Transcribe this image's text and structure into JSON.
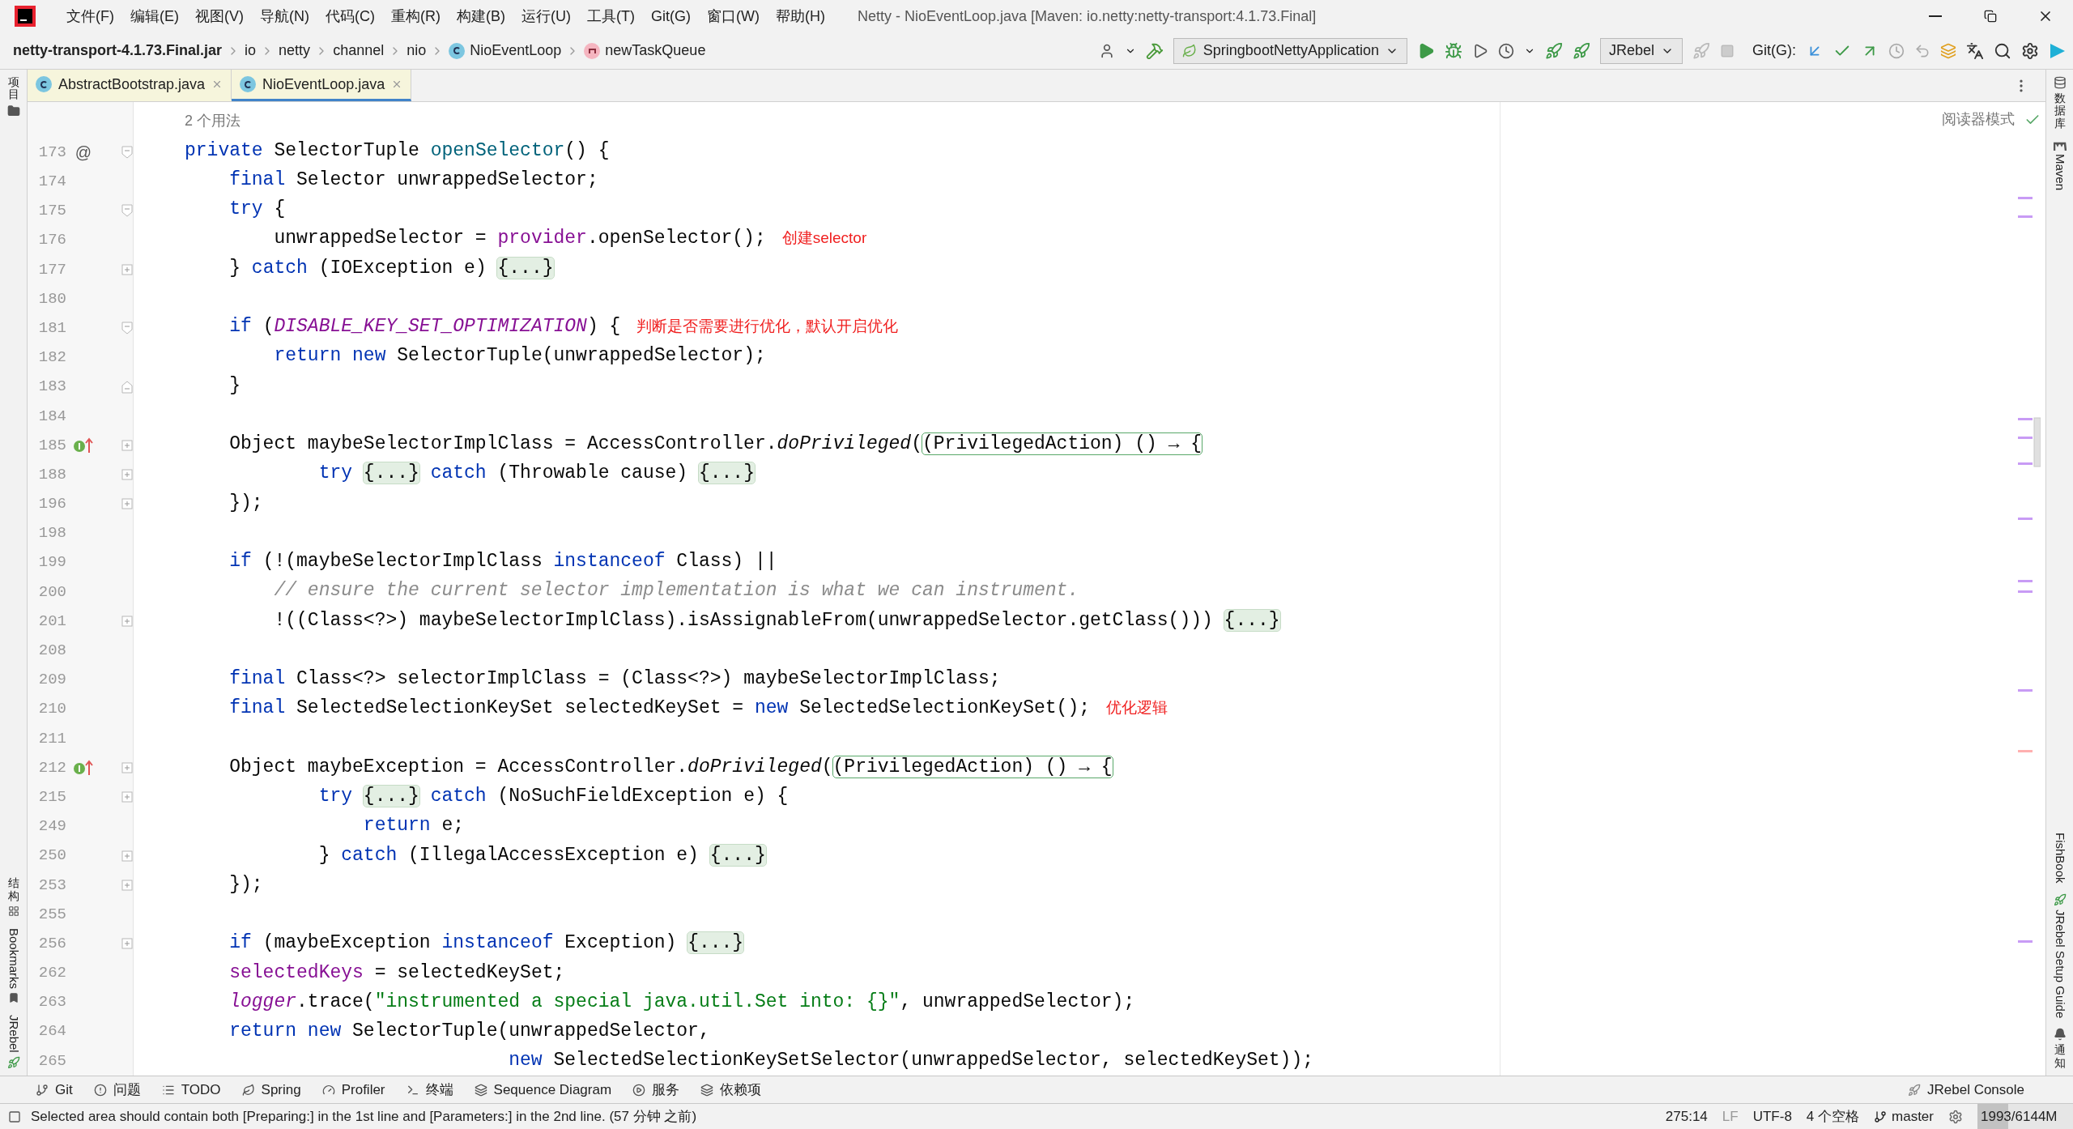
{
  "window": {
    "title": "Netty - NioEventLoop.java [Maven: io.netty:netty-transport:4.1.73.Final]"
  },
  "menu": [
    "文件(F)",
    "编辑(E)",
    "视图(V)",
    "导航(N)",
    "代码(C)",
    "重构(R)",
    "构建(B)",
    "运行(U)",
    "工具(T)",
    "Git(G)",
    "窗口(W)",
    "帮助(H)"
  ],
  "breadcrumbs": [
    {
      "label": "netty-transport-4.1.73.Final.jar",
      "kind": "jar"
    },
    {
      "label": "io",
      "kind": "package"
    },
    {
      "label": "netty",
      "kind": "package"
    },
    {
      "label": "channel",
      "kind": "package"
    },
    {
      "label": "nio",
      "kind": "package"
    },
    {
      "label": "NioEventLoop",
      "kind": "class"
    },
    {
      "label": "newTaskQueue",
      "kind": "method"
    }
  ],
  "toolbar": {
    "run_config": "SpringbootNettyApplication",
    "jrebel": "JRebel",
    "git_label": "Git(G):"
  },
  "tabs": [
    {
      "label": "AbstractBootstrap.java",
      "selected": false
    },
    {
      "label": "NioEventLoop.java",
      "selected": true
    }
  ],
  "editor": {
    "usages": "2 个用法",
    "reader_mode": "阅读器模式",
    "lines": [
      {
        "number": "173",
        "gutter_text": "@",
        "fold": {
          "kind": "start"
        },
        "tokens": [
          {
            "kind": "kw",
            "text": "private"
          },
          {
            "kind": "plain",
            "text": " SelectorTuple "
          },
          {
            "kind": "method",
            "text": "openSelector"
          },
          {
            "kind": "plain",
            "text": "() {"
          }
        ]
      },
      {
        "number": "174",
        "tokens": [
          {
            "kind": "kw",
            "text": "    final"
          },
          {
            "kind": "plain",
            "text": " Selector unwrappedSelector;"
          }
        ]
      },
      {
        "number": "175",
        "fold": {
          "kind": "start"
        },
        "tokens": [
          {
            "kind": "kw",
            "text": "    try"
          },
          {
            "kind": "plain",
            "text": " {"
          }
        ]
      },
      {
        "number": "176",
        "note": "创建selector",
        "tokens": [
          {
            "kind": "plain",
            "text": "        unwrappedSelector = "
          },
          {
            "kind": "field",
            "text": "provider"
          },
          {
            "kind": "plain",
            "text": ".openSelector();"
          }
        ]
      },
      {
        "number": "177",
        "fold": {
          "kind": "plus"
        },
        "tokens": [
          {
            "kind": "plain",
            "text": "    } "
          },
          {
            "kind": "kw",
            "text": "catch"
          },
          {
            "kind": "plain",
            "text": " (IOException e) "
          },
          {
            "kind": "fold",
            "text": "{...}"
          }
        ]
      },
      {
        "number": "180"
      },
      {
        "number": "181",
        "fold": {
          "kind": "start"
        },
        "note": "判断是否需要进行优化，默认开启优化",
        "tokens": [
          {
            "kind": "kw",
            "text": "    if"
          },
          {
            "kind": "plain",
            "text": " ("
          },
          {
            "kind": "const",
            "text": "DISABLE_KEY_SET_OPTIMIZATION"
          },
          {
            "kind": "plain",
            "text": ") {"
          }
        ]
      },
      {
        "number": "182",
        "tokens": [
          {
            "kind": "kw",
            "text": "        return new"
          },
          {
            "kind": "plain",
            "text": " SelectorTuple(unwrappedSelector);"
          }
        ]
      },
      {
        "number": "183",
        "fold": {
          "kind": "end"
        },
        "tokens": [
          {
            "kind": "plain",
            "text": "    }"
          }
        ]
      },
      {
        "number": "184"
      },
      {
        "number": "185",
        "gutter_icon": {
          "kind": "implemented"
        },
        "fold": {
          "kind": "plus"
        },
        "tokens": [
          {
            "kind": "plain",
            "text": "    Object maybeSelectorImplClass = AccessController."
          },
          {
            "kind": "static",
            "text": "doPrivileged"
          },
          {
            "kind": "plain",
            "text": "("
          },
          {
            "kind": "lambda",
            "text": "(PrivilegedAction) () → {"
          }
        ]
      },
      {
        "number": "188",
        "fold": {
          "kind": "plus"
        },
        "tokens": [
          {
            "kind": "kw",
            "text": "            try "
          },
          {
            "kind": "fold",
            "text": "{...}"
          },
          {
            "kind": "kw",
            "text": " catch"
          },
          {
            "kind": "plain",
            "text": " (Throwable cause) "
          },
          {
            "kind": "fold",
            "text": "{...}"
          }
        ]
      },
      {
        "number": "196",
        "fold": {
          "kind": "plus"
        },
        "tokens": [
          {
            "kind": "plain",
            "text": "    });"
          }
        ]
      },
      {
        "number": "198"
      },
      {
        "number": "199",
        "tokens": [
          {
            "kind": "kw",
            "text": "    if"
          },
          {
            "kind": "plain",
            "text": " (!(maybeSelectorImplClass "
          },
          {
            "kind": "kw",
            "text": "instanceof"
          },
          {
            "kind": "plain",
            "text": " Class) ||"
          }
        ]
      },
      {
        "number": "200",
        "tokens": [
          {
            "kind": "comment",
            "text": "        // ensure the current selector implementation is what we can instrument."
          }
        ]
      },
      {
        "number": "201",
        "fold": {
          "kind": "plus"
        },
        "tokens": [
          {
            "kind": "plain",
            "text": "        !((Class<?>) maybeSelectorImplClass).isAssignableFrom(unwrappedSelector.getClass())) "
          },
          {
            "kind": "fold",
            "text": "{...}"
          }
        ]
      },
      {
        "number": "208"
      },
      {
        "number": "209",
        "tokens": [
          {
            "kind": "kw",
            "text": "    final"
          },
          {
            "kind": "plain",
            "text": " Class<?> selectorImplClass = (Class<?>) maybeSelectorImplClass;"
          }
        ]
      },
      {
        "number": "210",
        "note": "优化逻辑",
        "tokens": [
          {
            "kind": "kw",
            "text": "    final"
          },
          {
            "kind": "plain",
            "text": " SelectedSelectionKeySet selectedKeySet = "
          },
          {
            "kind": "kw",
            "text": "new"
          },
          {
            "kind": "plain",
            "text": " SelectedSelectionKeySet();"
          }
        ]
      },
      {
        "number": "211"
      },
      {
        "number": "212",
        "gutter_icon": {
          "kind": "implemented"
        },
        "fold": {
          "kind": "plus"
        },
        "tokens": [
          {
            "kind": "plain",
            "text": "    Object maybeException = AccessController."
          },
          {
            "kind": "static",
            "text": "doPrivileged"
          },
          {
            "kind": "plain",
            "text": "("
          },
          {
            "kind": "lambda",
            "text": "(PrivilegedAction) () → {"
          }
        ]
      },
      {
        "number": "215",
        "fold": {
          "kind": "plus"
        },
        "tokens": [
          {
            "kind": "kw",
            "text": "            try "
          },
          {
            "kind": "fold",
            "text": "{...}"
          },
          {
            "kind": "kw",
            "text": " catch"
          },
          {
            "kind": "plain",
            "text": " (NoSuchFieldException e) {"
          }
        ]
      },
      {
        "number": "249",
        "tokens": [
          {
            "kind": "kw",
            "text": "                return"
          },
          {
            "kind": "plain",
            "text": " e;"
          }
        ]
      },
      {
        "number": "250",
        "fold": {
          "kind": "plus"
        },
        "tokens": [
          {
            "kind": "plain",
            "text": "            } "
          },
          {
            "kind": "kw",
            "text": "catch"
          },
          {
            "kind": "plain",
            "text": " (IllegalAccessException e) "
          },
          {
            "kind": "fold",
            "text": "{...}"
          }
        ]
      },
      {
        "number": "253",
        "fold": {
          "kind": "plus"
        },
        "tokens": [
          {
            "kind": "plain",
            "text": "    });"
          }
        ]
      },
      {
        "number": "255"
      },
      {
        "number": "256",
        "fold": {
          "kind": "plus"
        },
        "tokens": [
          {
            "kind": "kw",
            "text": "    if"
          },
          {
            "kind": "plain",
            "text": " (maybeException "
          },
          {
            "kind": "kw",
            "text": "instanceof"
          },
          {
            "kind": "plain",
            "text": " Exception) "
          },
          {
            "kind": "fold",
            "text": "{...}"
          }
        ]
      },
      {
        "number": "262",
        "tokens": [
          {
            "kind": "field",
            "text": "    selectedKeys"
          },
          {
            "kind": "plain",
            "text": " = selectedKeySet;"
          }
        ]
      },
      {
        "number": "263",
        "tokens": [
          {
            "kind": "staticfield",
            "text": "    logger"
          },
          {
            "kind": "plain",
            "text": ".trace("
          },
          {
            "kind": "string",
            "text": "\"instrumented a special java.util.Set into: {}\""
          },
          {
            "kind": "plain",
            "text": ", unwrappedSelector);"
          }
        ]
      },
      {
        "number": "264",
        "tokens": [
          {
            "kind": "kw",
            "text": "    return new"
          },
          {
            "kind": "plain",
            "text": " SelectorTuple(unwrappedSelector,"
          }
        ]
      },
      {
        "number": "265",
        "tokens": [
          {
            "kind": "kw",
            "text": "                             new"
          },
          {
            "kind": "plain",
            "text": " SelectedSelectionKeySetSelector(unwrappedSelector, selectedKeySet));"
          }
        ]
      }
    ]
  },
  "left_strip": {
    "top": [
      {
        "label": "项目",
        "kind": "cjk"
      }
    ],
    "bottom": [
      {
        "label": "结构",
        "kind": "cjk"
      },
      {
        "label": "Bookmarks",
        "kind": "latin"
      },
      {
        "label": "JRebel",
        "kind": "latin"
      }
    ]
  },
  "right_strip": {
    "top": [
      {
        "label": "数据库",
        "kind": "cjk"
      },
      {
        "label": "Maven",
        "kind": "latin"
      }
    ],
    "bottom": [
      {
        "label": "FishBook",
        "kind": "latin"
      },
      {
        "label": "JRebel Setup Guide",
        "kind": "latin"
      },
      {
        "label": "通知",
        "kind": "cjk"
      }
    ]
  },
  "tool_windows": [
    "Git",
    "问题",
    "TODO",
    "Spring",
    "Profiler",
    "终端",
    "Sequence Diagram",
    "服务",
    "依赖项"
  ],
  "jrebel_console": "JRebel Console",
  "status_bar": {
    "message": "Selected area should contain both [Preparing:] in the 1st line and [Parameters:] in the 2nd line. (57 分钟 之前)",
    "position": "275:14",
    "line_separator": "LF",
    "encoding": "UTF-8",
    "indent": "4 个空格",
    "branch": "master",
    "memory": {
      "reading": "1993/6144M",
      "level": 0.32
    }
  }
}
